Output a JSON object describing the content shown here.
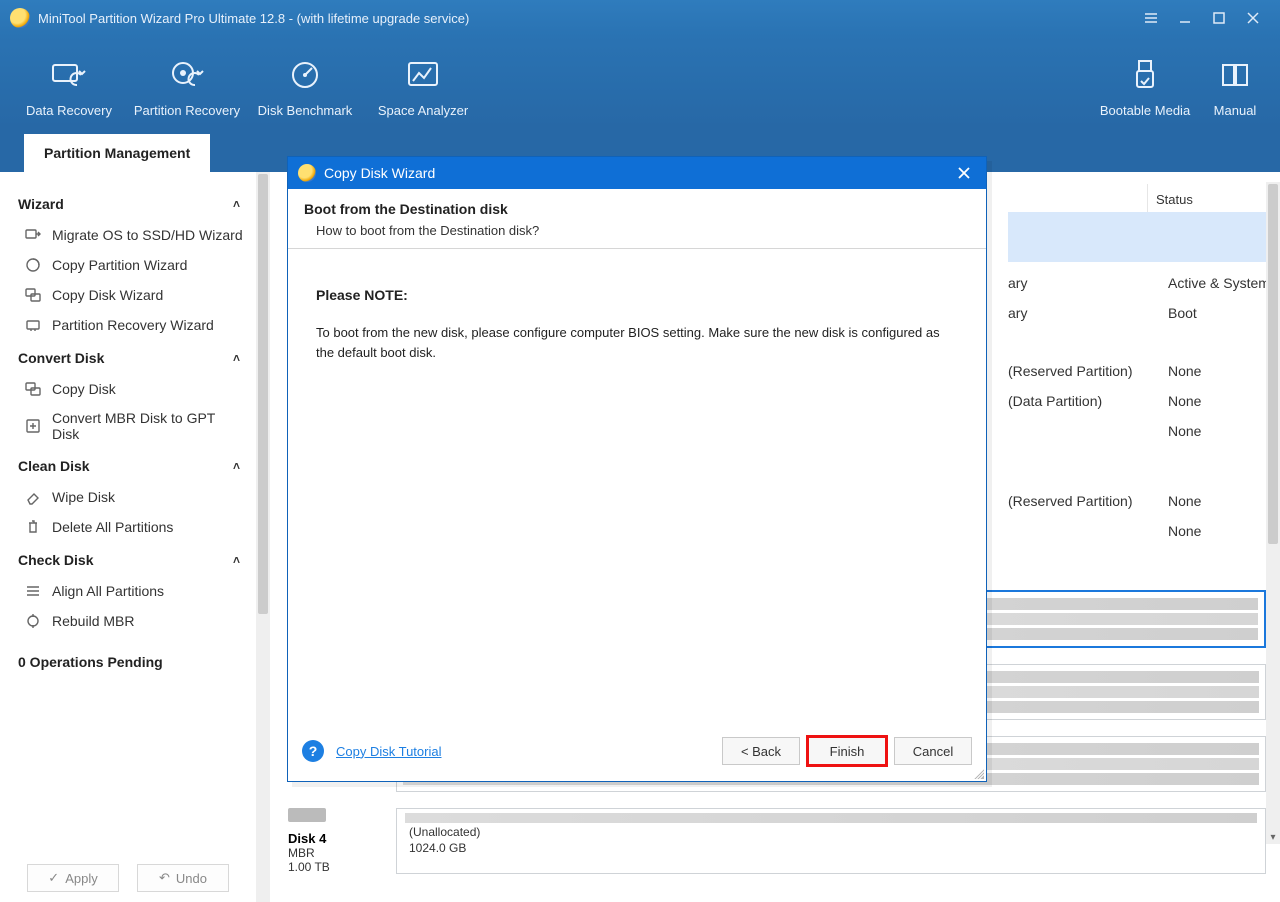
{
  "titlebar": {
    "title": "MiniTool Partition Wizard Pro Ultimate 12.8 - (with lifetime upgrade service)"
  },
  "toolbar": {
    "items": [
      {
        "label": "Data Recovery"
      },
      {
        "label": "Partition Recovery"
      },
      {
        "label": "Disk Benchmark"
      },
      {
        "label": "Space Analyzer"
      }
    ],
    "right": [
      {
        "label": "Bootable Media"
      },
      {
        "label": "Manual"
      }
    ]
  },
  "tab": "Partition Management",
  "sidebar": {
    "groups": [
      {
        "title": "Wizard",
        "items": [
          "Migrate OS to SSD/HD Wizard",
          "Copy Partition Wizard",
          "Copy Disk Wizard",
          "Partition Recovery Wizard"
        ]
      },
      {
        "title": "Convert Disk",
        "items": [
          "Copy Disk",
          "Convert MBR Disk to GPT Disk"
        ]
      },
      {
        "title": "Clean Disk",
        "items": [
          "Wipe Disk",
          "Delete All Partitions"
        ]
      },
      {
        "title": "Check Disk",
        "items": [
          "Align All Partitions",
          "Rebuild MBR"
        ]
      }
    ],
    "pending": "0 Operations Pending",
    "apply": "Apply",
    "undo": "Undo"
  },
  "right": {
    "status_col": "Status",
    "rows": [
      {
        "type": "ary",
        "status": "Active & System"
      },
      {
        "type": "ary",
        "status": "Boot"
      },
      {
        "type": "(Reserved Partition)",
        "status": "None"
      },
      {
        "type": "(Data Partition)",
        "status": "None"
      },
      {
        "type": "",
        "status": "None"
      },
      {
        "type": "(Reserved Partition)",
        "status": "None"
      },
      {
        "type": "",
        "status": "None"
      }
    ]
  },
  "disks": [
    {
      "name": "Disk 4",
      "scheme": "MBR",
      "size": "1.00 TB",
      "unalloc_label": "(Unallocated)",
      "unalloc_size": "1024.0 GB"
    }
  ],
  "modal": {
    "title": "Copy Disk Wizard",
    "heading": "Boot from the Destination disk",
    "subheading": "How to boot from the Destination disk?",
    "note_label": "Please NOTE:",
    "note_body": "To boot from the new disk, please configure computer BIOS setting. Make sure the new disk is configured as the default boot disk.",
    "tutorial": "Copy Disk Tutorial",
    "back": "<  Back",
    "finish": "Finish",
    "cancel": "Cancel"
  }
}
